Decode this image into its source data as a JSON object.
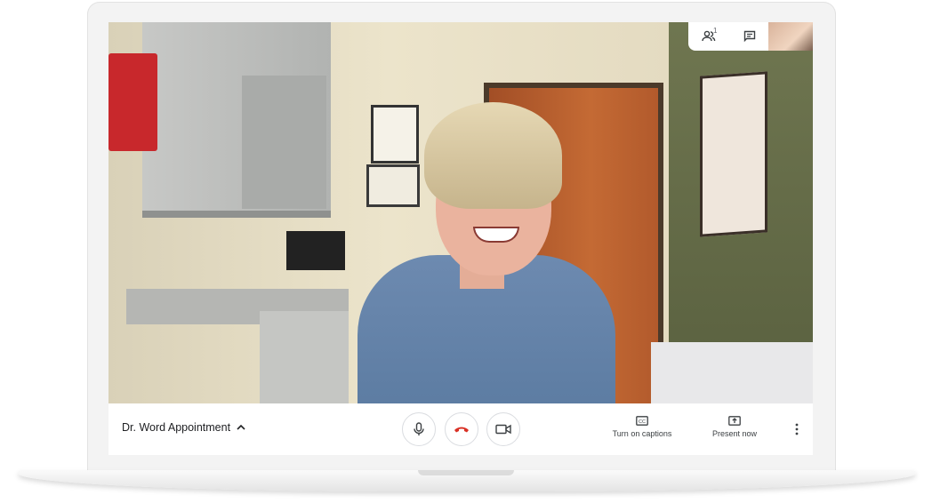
{
  "meeting": {
    "title": "Dr. Word Appointment",
    "participant_count": "1"
  },
  "controls": {
    "captions_label": "Turn on captions",
    "present_label": "Present now"
  },
  "icons": {
    "participants": "people-icon",
    "chat": "chat-icon",
    "mic": "mic-icon",
    "hangup": "hangup-icon",
    "camera": "camera-icon",
    "captions": "captions-icon",
    "present": "present-icon",
    "more": "more-vert-icon",
    "title_toggle": "chevron-up-icon"
  },
  "colors": {
    "hangup": "#d93025",
    "icon": "#3c4043",
    "border": "#dadce0"
  }
}
